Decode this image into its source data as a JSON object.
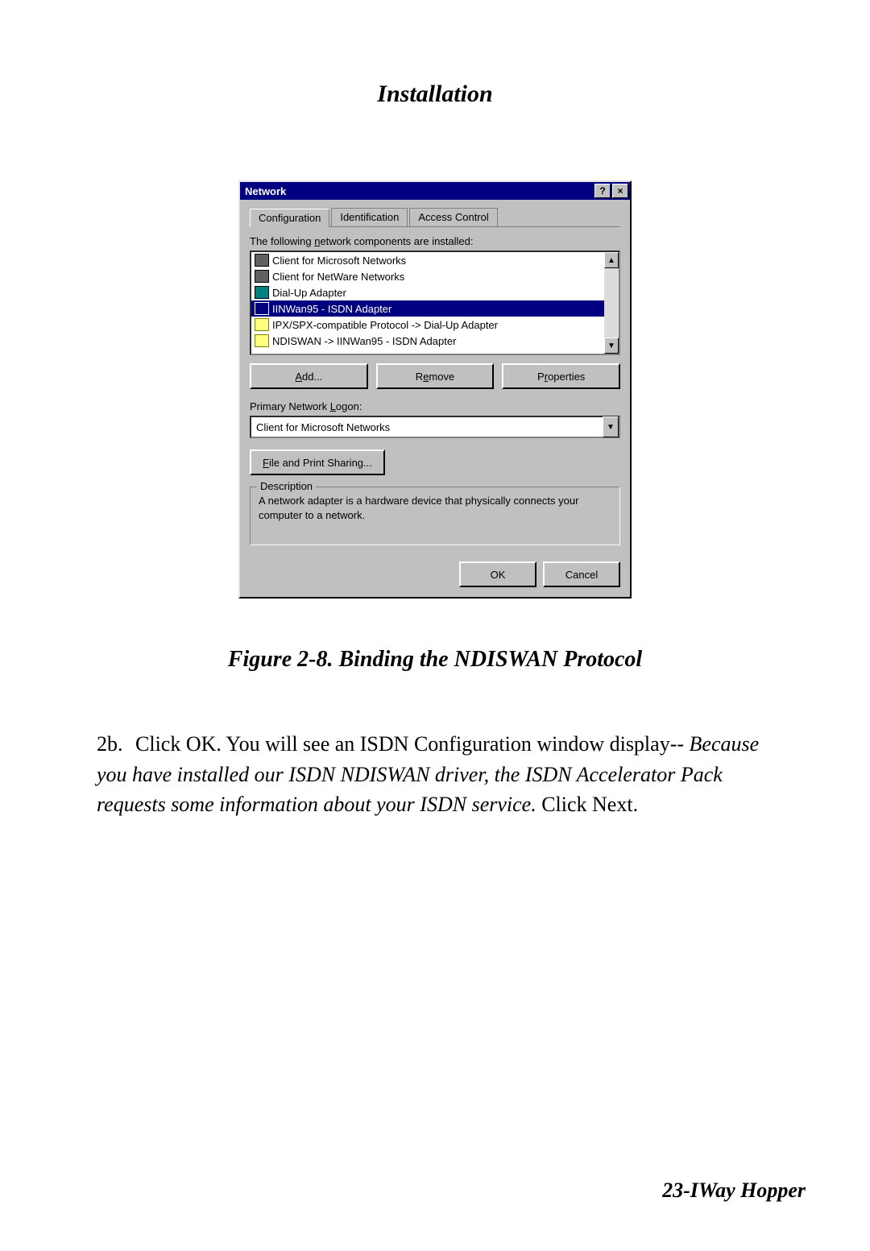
{
  "doc": {
    "title": "Installation",
    "figure_caption": "Figure 2-8.  Binding the NDISWAN Protocol",
    "step_number": "2b.",
    "step_text_1": "Click OK. You will see an ISDN Configuration window display-- ",
    "step_text_italic": "Because you have installed our ISDN NDISWAN driver, the ISDN Accelerator Pack requests some information about your ISDN service.",
    "step_text_2": "  Click Next.",
    "footer": "23-IWay Hopper"
  },
  "dialog": {
    "title": "Network",
    "help_btn": "?",
    "close_btn": "×",
    "tabs": [
      "Configuration",
      "Identification",
      "Access Control"
    ],
    "active_tab": 0,
    "components_label": "The following network components are installed:",
    "items": [
      {
        "icon": "client",
        "label": "Client for Microsoft Networks",
        "selected": false
      },
      {
        "icon": "client",
        "label": "Client for NetWare Networks",
        "selected": false
      },
      {
        "icon": "adapter",
        "label": "Dial-Up Adapter",
        "selected": false
      },
      {
        "icon": "adapter2",
        "label": "IINWan95 - ISDN Adapter",
        "selected": true
      },
      {
        "icon": "protocol",
        "label": "IPX/SPX-compatible Protocol -> Dial-Up Adapter",
        "selected": false
      },
      {
        "icon": "protocol",
        "label": "NDISWAN -> IINWan95 - ISDN Adapter",
        "selected": false
      }
    ],
    "buttons": {
      "add": "Add...",
      "remove": "Remove",
      "properties": "Properties"
    },
    "primary_logon_label": "Primary Network Logon:",
    "primary_logon_value": "Client for Microsoft Networks",
    "file_print_sharing": "File and Print Sharing...",
    "description_title": "Description",
    "description_text": "A network adapter is a hardware device that physically connects your computer to a network.",
    "ok": "OK",
    "cancel": "Cancel",
    "scroll_up": "▲",
    "scroll_down": "▼",
    "dropdown_arrow": "▼"
  }
}
